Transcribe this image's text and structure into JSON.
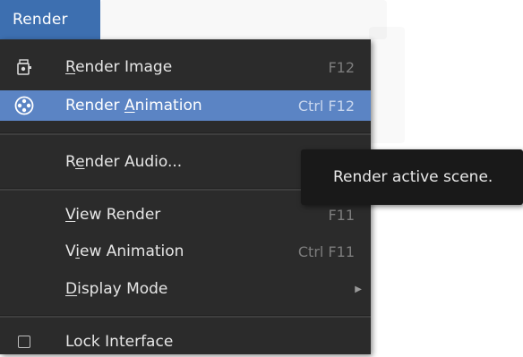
{
  "menu": {
    "title": "Render"
  },
  "items": [
    {
      "label_pre": "",
      "label_ul": "R",
      "label_post": "ender Image",
      "shortcut": "F12",
      "icon": "render-still-icon"
    },
    {
      "label_pre": "Render ",
      "label_ul": "A",
      "label_post": "nimation",
      "shortcut": "Ctrl F12",
      "icon": "render-animation-icon"
    },
    {
      "label_pre": "R",
      "label_ul": "e",
      "label_post": "nder Audio...",
      "shortcut": ""
    },
    {
      "label_pre": "",
      "label_ul": "V",
      "label_post": "iew Render",
      "shortcut": "F11"
    },
    {
      "label_pre": "V",
      "label_ul": "i",
      "label_post": "ew Animation",
      "shortcut": "Ctrl F11"
    },
    {
      "label_pre": "",
      "label_ul": "D",
      "label_post": "isplay Mode",
      "shortcut": ""
    },
    {
      "label_pre": "",
      "label_ul": "",
      "label_post": "Lock Interface",
      "shortcut": ""
    }
  ],
  "tooltip": {
    "text": "Render active scene."
  },
  "colors": {
    "menu_tab": "#3d6fb0",
    "highlight": "#5b84c4",
    "background": "#2b2b2b"
  }
}
